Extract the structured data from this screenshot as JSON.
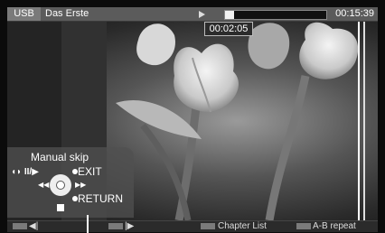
{
  "topbar": {
    "source": "USB",
    "channel": "Das Erste",
    "total_time": "00:15:39",
    "progress": 0.09
  },
  "current_time": "00:02:05",
  "skip_panel": {
    "title": "Manual skip",
    "mode_symbols": "ᴅᴅII/▶",
    "exit": "EXIT",
    "return": "RETURN"
  },
  "bottombar": {
    "chapter_list": "Chapter List",
    "ab_repeat": "A-B repeat",
    "skip_back_icon": "skip-back-icon",
    "skip_forward_icon": "skip-forward-icon"
  },
  "colors": {
    "bar": "#5b5b5b",
    "panel": "#505050",
    "key": "#7b7b7b"
  }
}
